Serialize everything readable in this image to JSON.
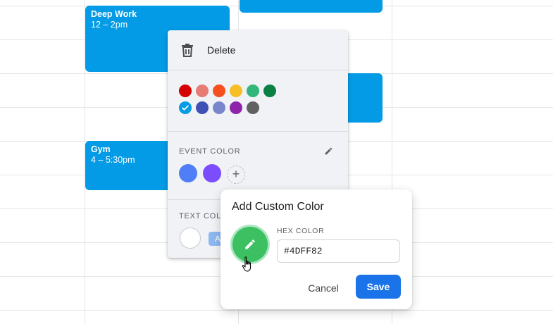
{
  "events": [
    {
      "title": "Deep Work",
      "time": "12 – 2pm"
    },
    {
      "title": "",
      "time": ""
    },
    {
      "title": "",
      "time": ""
    },
    {
      "title": "Gym",
      "time": "4 – 5:30pm"
    }
  ],
  "colors": {
    "event_default": "#039be5",
    "menu_background": "#f0f2f6",
    "primary_button": "#1a73e8"
  },
  "color_menu": {
    "delete_label": "Delete",
    "delete_icon": "trash-icon",
    "palette": [
      {
        "name": "tomato",
        "hex": "#d50000",
        "selected": false
      },
      {
        "name": "flamingo",
        "hex": "#e67c73",
        "selected": false
      },
      {
        "name": "tangerine",
        "hex": "#f4511e",
        "selected": false
      },
      {
        "name": "banana",
        "hex": "#f6bf26",
        "selected": false
      },
      {
        "name": "sage",
        "hex": "#33b679",
        "selected": false
      },
      {
        "name": "basil",
        "hex": "#0b8043",
        "selected": false
      },
      {
        "name": "peacock",
        "hex": "#039be5",
        "selected": true
      },
      {
        "name": "blueberry",
        "hex": "#3f51b5",
        "selected": false
      },
      {
        "name": "lavender",
        "hex": "#7986cb",
        "selected": false
      },
      {
        "name": "grape",
        "hex": "#8e24aa",
        "selected": false
      },
      {
        "name": "graphite",
        "hex": "#616161",
        "selected": false
      }
    ],
    "event_color_label": "EVENT COLOR",
    "custom_event_colors": [
      "#4f7ef7",
      "#7c4dff"
    ],
    "add_color_symbol": "+",
    "text_color_label": "TEXT COLOR",
    "text_color_sample": "A"
  },
  "custom_color_dialog": {
    "title": "Add Custom Color",
    "preview_color": "#3cc062",
    "hex_label": "HEX COLOR",
    "hex_value": "#4DFF82",
    "cancel_label": "Cancel",
    "save_label": "Save"
  }
}
